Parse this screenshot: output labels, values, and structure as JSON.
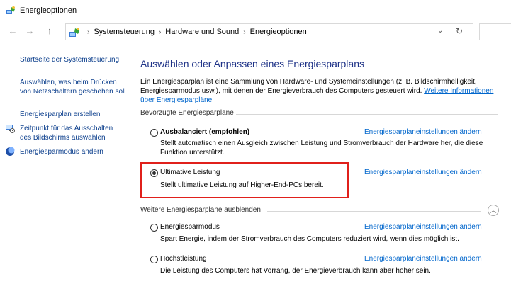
{
  "window": {
    "title": "Energieoptionen",
    "icon": "power-options-icon"
  },
  "nav": {
    "back_icon": "←",
    "forward_icon": "→",
    "up_icon": "↑",
    "breadcrumbs": [
      "Systemsteuerung",
      "Hardware und Sound",
      "Energieoptionen"
    ],
    "separator": "›",
    "dropdown_icon": "⌄",
    "refresh_icon": "↻"
  },
  "sidebar": {
    "items": [
      {
        "label": "Startseite der Systemsteuerung"
      },
      {
        "label": "Auswählen, was beim Drücken von Netzschaltern geschehen soll"
      },
      {
        "label": "Energiesparplan erstellen"
      },
      {
        "label": "Zeitpunkt für das Ausschalten des Bildschirms auswählen",
        "icon": "monitor-clock-icon"
      },
      {
        "label": "Energiesparmodus ändern",
        "icon": "moon-icon"
      }
    ]
  },
  "main": {
    "title": "Auswählen oder Anpassen eines Energiesparplans",
    "intro_text": "Ein Energiesparplan ist eine Sammlung von Hardware- und Systemeinstellungen (z. B. Bildschirmhelligkeit, Energiesparmodus usw.), mit denen der Energieverbrauch des Computers gesteuert wird. ",
    "intro_link": "Weitere Informationen über Energiesparpläne",
    "preferred_label": "Bevorzugte Energiesparpläne",
    "more_label": "Weitere Energiesparpläne ausblenden",
    "change_link": "Energiesparplaneinstellungen ändern",
    "plans": [
      {
        "name": "Ausbalanciert (empfohlen)",
        "desc": "Stellt automatisch einen Ausgleich zwischen Leistung und Stromverbrauch der Hardware her, die diese Funktion unterstützt.",
        "selected": false
      },
      {
        "name": "Ultimative Leistung",
        "desc": "Stellt ultimative Leistung auf Higher-End-PCs bereit.",
        "selected": true
      },
      {
        "name": "Energiesparmodus",
        "desc": "Spart Energie, indem der Stromverbrauch des Computers reduziert wird, wenn dies möglich ist.",
        "selected": false
      },
      {
        "name": "Höchstleistung",
        "desc": "Die Leistung des Computers hat Vorrang, der Energieverbrauch kann aber höher sein.",
        "selected": false
      }
    ]
  },
  "colors": {
    "highlight": "#e0201b",
    "link": "#0066cc",
    "title": "#1e3287"
  }
}
